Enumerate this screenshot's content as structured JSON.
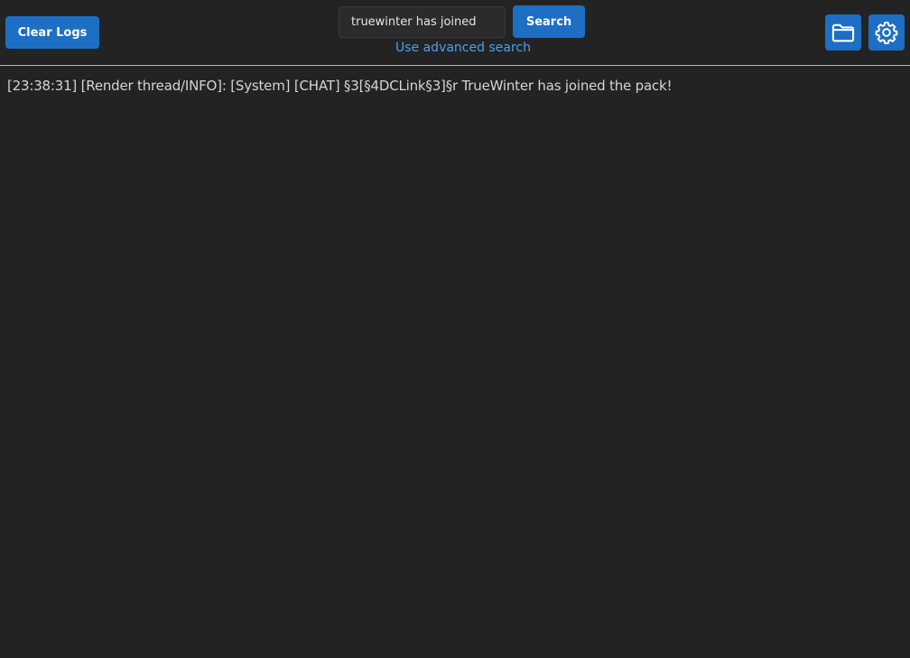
{
  "toolbar": {
    "clear_label": "Clear Logs",
    "search_value": "truewinter has joined",
    "search_label": "Search",
    "advanced_link": "Use advanced search",
    "folder_icon": "folder-icon",
    "settings_icon": "gear-icon"
  },
  "logs": {
    "lines": [
      "[23:38:31] [Render thread/INFO]: [System] [CHAT] §3[§4DCLink§3]§r TrueWinter has joined the pack!"
    ]
  },
  "colors": {
    "background": "#232323",
    "accent": "#1c6fc4",
    "link": "#4aa0f0",
    "text": "#d4d4d4"
  }
}
